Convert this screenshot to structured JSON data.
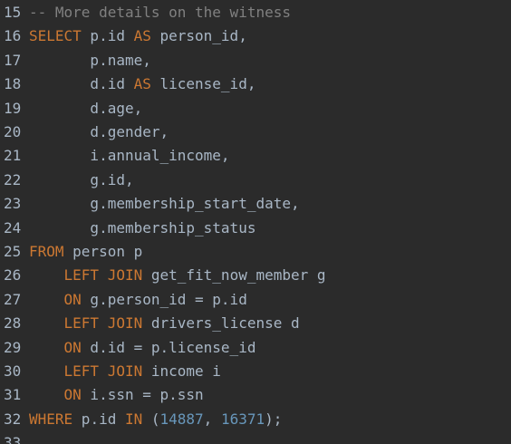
{
  "editor": {
    "lines": [
      {
        "number": "15",
        "tokens": [
          {
            "type": "cm",
            "text": "-- More details on the witness"
          }
        ]
      },
      {
        "number": "16",
        "tokens": [
          {
            "type": "kw",
            "text": "SELECT"
          },
          {
            "type": "id",
            "text": " p.id "
          },
          {
            "type": "kw",
            "text": "AS"
          },
          {
            "type": "id",
            "text": " person_id,"
          }
        ]
      },
      {
        "number": "17",
        "tokens": [
          {
            "type": "id",
            "text": "       p.name,"
          }
        ]
      },
      {
        "number": "18",
        "tokens": [
          {
            "type": "id",
            "text": "       d.id "
          },
          {
            "type": "kw",
            "text": "AS"
          },
          {
            "type": "id",
            "text": " license_id,"
          }
        ]
      },
      {
        "number": "19",
        "tokens": [
          {
            "type": "id",
            "text": "       d.age,"
          }
        ]
      },
      {
        "number": "20",
        "tokens": [
          {
            "type": "id",
            "text": "       d.gender,"
          }
        ]
      },
      {
        "number": "21",
        "tokens": [
          {
            "type": "id",
            "text": "       i.annual_income,"
          }
        ]
      },
      {
        "number": "22",
        "tokens": [
          {
            "type": "id",
            "text": "       g.id,"
          }
        ]
      },
      {
        "number": "23",
        "tokens": [
          {
            "type": "id",
            "text": "       g.membership_start_date,"
          }
        ]
      },
      {
        "number": "24",
        "tokens": [
          {
            "type": "id",
            "text": "       g.membership_status"
          }
        ]
      },
      {
        "number": "25",
        "tokens": [
          {
            "type": "kw",
            "text": "FROM"
          },
          {
            "type": "id",
            "text": " person p"
          }
        ]
      },
      {
        "number": "26",
        "tokens": [
          {
            "type": "id",
            "text": "    "
          },
          {
            "type": "kw",
            "text": "LEFT JOIN"
          },
          {
            "type": "id",
            "text": " get_fit_now_member g"
          }
        ]
      },
      {
        "number": "27",
        "tokens": [
          {
            "type": "id",
            "text": "    "
          },
          {
            "type": "kw",
            "text": "ON"
          },
          {
            "type": "id",
            "text": " g.person_id = p.id"
          }
        ]
      },
      {
        "number": "28",
        "tokens": [
          {
            "type": "id",
            "text": "    "
          },
          {
            "type": "kw",
            "text": "LEFT JOIN"
          },
          {
            "type": "id",
            "text": " drivers_license d"
          }
        ]
      },
      {
        "number": "29",
        "tokens": [
          {
            "type": "id",
            "text": "    "
          },
          {
            "type": "kw",
            "text": "ON"
          },
          {
            "type": "id",
            "text": " d.id = p.license_id"
          }
        ]
      },
      {
        "number": "30",
        "tokens": [
          {
            "type": "id",
            "text": "    "
          },
          {
            "type": "kw",
            "text": "LEFT JOIN"
          },
          {
            "type": "id",
            "text": " income i"
          }
        ]
      },
      {
        "number": "31",
        "tokens": [
          {
            "type": "id",
            "text": "    "
          },
          {
            "type": "kw",
            "text": "ON"
          },
          {
            "type": "id",
            "text": " i.ssn = p.ssn"
          }
        ]
      },
      {
        "number": "32",
        "tokens": [
          {
            "type": "kw",
            "text": "WHERE"
          },
          {
            "type": "id",
            "text": " p.id "
          },
          {
            "type": "kw",
            "text": "IN"
          },
          {
            "type": "id",
            "text": " ("
          },
          {
            "type": "num",
            "text": "14887"
          },
          {
            "type": "id",
            "text": ", "
          },
          {
            "type": "num",
            "text": "16371"
          },
          {
            "type": "id",
            "text": ");"
          }
        ]
      },
      {
        "number": "33",
        "tokens": []
      }
    ]
  }
}
